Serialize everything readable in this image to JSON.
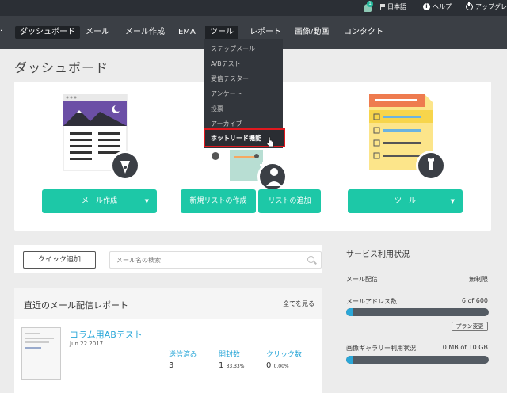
{
  "topbar": {
    "notification_count": "1",
    "language": "日本語",
    "help": "ヘルプ",
    "upgrade": "アップグレ"
  },
  "nav": {
    "items": [
      {
        "label": "ダッシュボード"
      },
      {
        "label": "メール"
      },
      {
        "label": "メール作成"
      },
      {
        "label": "EMA"
      },
      {
        "label": "ツール"
      },
      {
        "label": "レポート"
      },
      {
        "label": "画像/動画"
      },
      {
        "label": "コンタクト"
      }
    ]
  },
  "tools_menu": {
    "items": [
      "ステップメール",
      "A/Bテスト",
      "受信テスター",
      "アンケート",
      "投票",
      "アーカイブ"
    ],
    "highlighted": "ホットリード機能"
  },
  "page_title": "ダッシュボード",
  "dashboard": {
    "compose_button": "メール作成",
    "new_list_button": "新規リストの作成",
    "add_list_button": "リストの追加",
    "tools_button": "ツール"
  },
  "quick": {
    "button": "クイック追加",
    "search_placeholder": "メール名の検索"
  },
  "report": {
    "title": "直近のメール配信レポート",
    "view_all": "全てを見る",
    "subject": "コラム用ABテスト",
    "date": "Jun 22 2017",
    "sent_label": "送信済み",
    "sent_value": "3",
    "opens_label": "開封数",
    "opens_value": "1",
    "opens_pct": "33.33%",
    "clicks_label": "クリック数",
    "clicks_value": "0",
    "clicks_pct": "0.00%"
  },
  "service": {
    "title": "サービス利用状況",
    "delivery_label": "メール配信",
    "delivery_value": "無制限",
    "address_label": "メールアドレス数",
    "address_value": "6 of 600",
    "address_fraction": 0.01,
    "plan_button": "プラン変更",
    "gallery_label": "画像ギャラリー利用状況",
    "gallery_value": "0 MB of 10 GB",
    "gallery_fraction": 0.0
  },
  "colors": {
    "accent_green": "#1dc8a7",
    "link_blue": "#2aa7d8",
    "highlight_red": "#e0191f",
    "nav_bg": "#3b3f45"
  }
}
